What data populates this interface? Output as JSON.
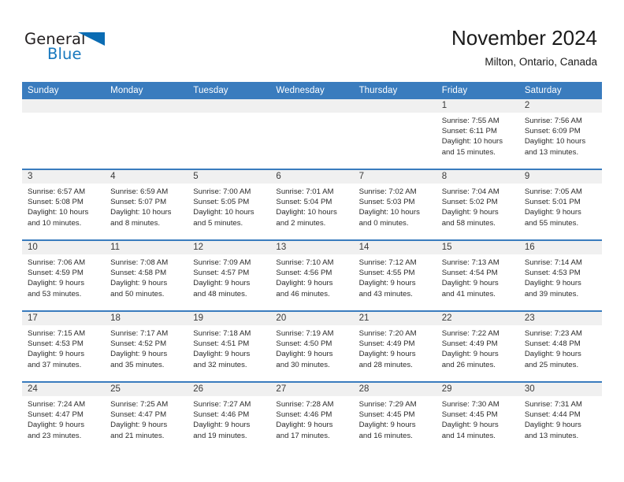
{
  "brand": {
    "name_part1": "General",
    "name_part2": "Blue",
    "triangle_color": "#0b6cb3",
    "blue_text_color": "#1878be"
  },
  "header": {
    "title": "November 2024",
    "subtitle": "Milton, Ontario, Canada",
    "accent_color": "#3a7cbe",
    "band_color": "#f0f0f0"
  },
  "weekday_headers": [
    "Sunday",
    "Monday",
    "Tuesday",
    "Wednesday",
    "Thursday",
    "Friday",
    "Saturday"
  ],
  "weeks": [
    [
      {
        "day": "",
        "sunrise": "",
        "sunset": "",
        "daylight_1": "",
        "daylight_2": ""
      },
      {
        "day": "",
        "sunrise": "",
        "sunset": "",
        "daylight_1": "",
        "daylight_2": ""
      },
      {
        "day": "",
        "sunrise": "",
        "sunset": "",
        "daylight_1": "",
        "daylight_2": ""
      },
      {
        "day": "",
        "sunrise": "",
        "sunset": "",
        "daylight_1": "",
        "daylight_2": ""
      },
      {
        "day": "",
        "sunrise": "",
        "sunset": "",
        "daylight_1": "",
        "daylight_2": ""
      },
      {
        "day": "1",
        "sunrise": "Sunrise: 7:55 AM",
        "sunset": "Sunset: 6:11 PM",
        "daylight_1": "Daylight: 10 hours",
        "daylight_2": "and 15 minutes."
      },
      {
        "day": "2",
        "sunrise": "Sunrise: 7:56 AM",
        "sunset": "Sunset: 6:09 PM",
        "daylight_1": "Daylight: 10 hours",
        "daylight_2": "and 13 minutes."
      }
    ],
    [
      {
        "day": "3",
        "sunrise": "Sunrise: 6:57 AM",
        "sunset": "Sunset: 5:08 PM",
        "daylight_1": "Daylight: 10 hours",
        "daylight_2": "and 10 minutes."
      },
      {
        "day": "4",
        "sunrise": "Sunrise: 6:59 AM",
        "sunset": "Sunset: 5:07 PM",
        "daylight_1": "Daylight: 10 hours",
        "daylight_2": "and 8 minutes."
      },
      {
        "day": "5",
        "sunrise": "Sunrise: 7:00 AM",
        "sunset": "Sunset: 5:05 PM",
        "daylight_1": "Daylight: 10 hours",
        "daylight_2": "and 5 minutes."
      },
      {
        "day": "6",
        "sunrise": "Sunrise: 7:01 AM",
        "sunset": "Sunset: 5:04 PM",
        "daylight_1": "Daylight: 10 hours",
        "daylight_2": "and 2 minutes."
      },
      {
        "day": "7",
        "sunrise": "Sunrise: 7:02 AM",
        "sunset": "Sunset: 5:03 PM",
        "daylight_1": "Daylight: 10 hours",
        "daylight_2": "and 0 minutes."
      },
      {
        "day": "8",
        "sunrise": "Sunrise: 7:04 AM",
        "sunset": "Sunset: 5:02 PM",
        "daylight_1": "Daylight: 9 hours",
        "daylight_2": "and 58 minutes."
      },
      {
        "day": "9",
        "sunrise": "Sunrise: 7:05 AM",
        "sunset": "Sunset: 5:01 PM",
        "daylight_1": "Daylight: 9 hours",
        "daylight_2": "and 55 minutes."
      }
    ],
    [
      {
        "day": "10",
        "sunrise": "Sunrise: 7:06 AM",
        "sunset": "Sunset: 4:59 PM",
        "daylight_1": "Daylight: 9 hours",
        "daylight_2": "and 53 minutes."
      },
      {
        "day": "11",
        "sunrise": "Sunrise: 7:08 AM",
        "sunset": "Sunset: 4:58 PM",
        "daylight_1": "Daylight: 9 hours",
        "daylight_2": "and 50 minutes."
      },
      {
        "day": "12",
        "sunrise": "Sunrise: 7:09 AM",
        "sunset": "Sunset: 4:57 PM",
        "daylight_1": "Daylight: 9 hours",
        "daylight_2": "and 48 minutes."
      },
      {
        "day": "13",
        "sunrise": "Sunrise: 7:10 AM",
        "sunset": "Sunset: 4:56 PM",
        "daylight_1": "Daylight: 9 hours",
        "daylight_2": "and 46 minutes."
      },
      {
        "day": "14",
        "sunrise": "Sunrise: 7:12 AM",
        "sunset": "Sunset: 4:55 PM",
        "daylight_1": "Daylight: 9 hours",
        "daylight_2": "and 43 minutes."
      },
      {
        "day": "15",
        "sunrise": "Sunrise: 7:13 AM",
        "sunset": "Sunset: 4:54 PM",
        "daylight_1": "Daylight: 9 hours",
        "daylight_2": "and 41 minutes."
      },
      {
        "day": "16",
        "sunrise": "Sunrise: 7:14 AM",
        "sunset": "Sunset: 4:53 PM",
        "daylight_1": "Daylight: 9 hours",
        "daylight_2": "and 39 minutes."
      }
    ],
    [
      {
        "day": "17",
        "sunrise": "Sunrise: 7:15 AM",
        "sunset": "Sunset: 4:53 PM",
        "daylight_1": "Daylight: 9 hours",
        "daylight_2": "and 37 minutes."
      },
      {
        "day": "18",
        "sunrise": "Sunrise: 7:17 AM",
        "sunset": "Sunset: 4:52 PM",
        "daylight_1": "Daylight: 9 hours",
        "daylight_2": "and 35 minutes."
      },
      {
        "day": "19",
        "sunrise": "Sunrise: 7:18 AM",
        "sunset": "Sunset: 4:51 PM",
        "daylight_1": "Daylight: 9 hours",
        "daylight_2": "and 32 minutes."
      },
      {
        "day": "20",
        "sunrise": "Sunrise: 7:19 AM",
        "sunset": "Sunset: 4:50 PM",
        "daylight_1": "Daylight: 9 hours",
        "daylight_2": "and 30 minutes."
      },
      {
        "day": "21",
        "sunrise": "Sunrise: 7:20 AM",
        "sunset": "Sunset: 4:49 PM",
        "daylight_1": "Daylight: 9 hours",
        "daylight_2": "and 28 minutes."
      },
      {
        "day": "22",
        "sunrise": "Sunrise: 7:22 AM",
        "sunset": "Sunset: 4:49 PM",
        "daylight_1": "Daylight: 9 hours",
        "daylight_2": "and 26 minutes."
      },
      {
        "day": "23",
        "sunrise": "Sunrise: 7:23 AM",
        "sunset": "Sunset: 4:48 PM",
        "daylight_1": "Daylight: 9 hours",
        "daylight_2": "and 25 minutes."
      }
    ],
    [
      {
        "day": "24",
        "sunrise": "Sunrise: 7:24 AM",
        "sunset": "Sunset: 4:47 PM",
        "daylight_1": "Daylight: 9 hours",
        "daylight_2": "and 23 minutes."
      },
      {
        "day": "25",
        "sunrise": "Sunrise: 7:25 AM",
        "sunset": "Sunset: 4:47 PM",
        "daylight_1": "Daylight: 9 hours",
        "daylight_2": "and 21 minutes."
      },
      {
        "day": "26",
        "sunrise": "Sunrise: 7:27 AM",
        "sunset": "Sunset: 4:46 PM",
        "daylight_1": "Daylight: 9 hours",
        "daylight_2": "and 19 minutes."
      },
      {
        "day": "27",
        "sunrise": "Sunrise: 7:28 AM",
        "sunset": "Sunset: 4:46 PM",
        "daylight_1": "Daylight: 9 hours",
        "daylight_2": "and 17 minutes."
      },
      {
        "day": "28",
        "sunrise": "Sunrise: 7:29 AM",
        "sunset": "Sunset: 4:45 PM",
        "daylight_1": "Daylight: 9 hours",
        "daylight_2": "and 16 minutes."
      },
      {
        "day": "29",
        "sunrise": "Sunrise: 7:30 AM",
        "sunset": "Sunset: 4:45 PM",
        "daylight_1": "Daylight: 9 hours",
        "daylight_2": "and 14 minutes."
      },
      {
        "day": "30",
        "sunrise": "Sunrise: 7:31 AM",
        "sunset": "Sunset: 4:44 PM",
        "daylight_1": "Daylight: 9 hours",
        "daylight_2": "and 13 minutes."
      }
    ]
  ]
}
